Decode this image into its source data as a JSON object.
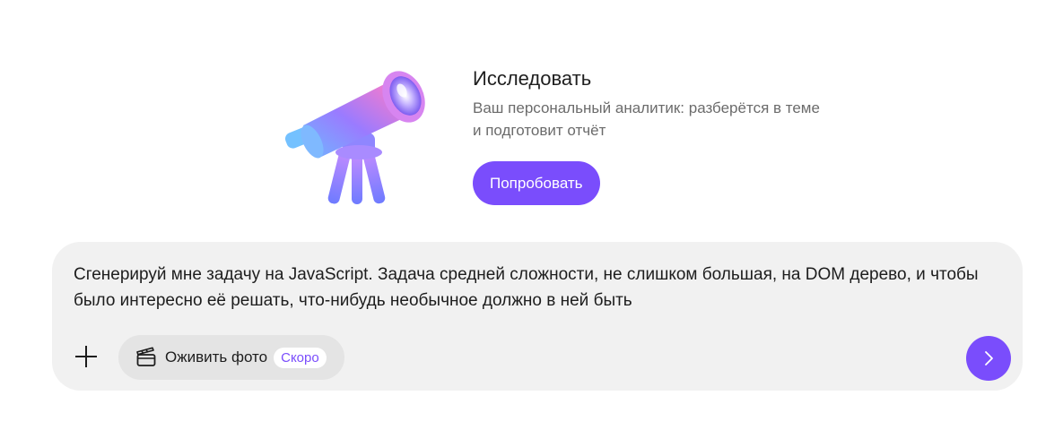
{
  "promo": {
    "title": "Исследовать",
    "description": "Ваш персональный аналитик: разберётся в теме и подготовит отчёт",
    "button_label": "Попробовать",
    "illustration": "telescope-illustration"
  },
  "composer": {
    "prompt_text": "Сгенерируй мне задачу на JavaScript. Задача средней сложности, не слишком большая, на DOM дерево, и чтобы было интересно её решать, что-нибудь необычное должно в ней быть",
    "add_icon": "plus-icon",
    "chip": {
      "icon": "clapperboard-icon",
      "label": "Оживить фото",
      "badge": "Скоро"
    },
    "send_icon": "chevron-right-icon"
  },
  "colors": {
    "accent": "#7a4dfc",
    "composer_bg": "#f1f1f1",
    "chip_bg": "#e4e4e4",
    "muted_text": "#6b6b6b"
  }
}
